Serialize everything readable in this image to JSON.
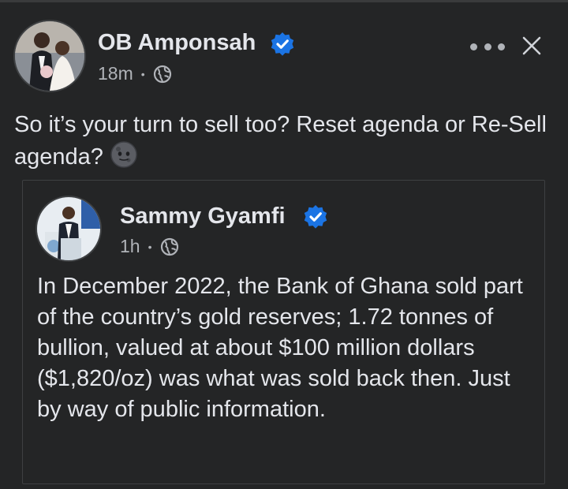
{
  "post": {
    "author": "OB Amponsah",
    "time": "18m",
    "text": "So it’s your turn to sell too? Reset agenda or Re-Sell agenda?",
    "emoji": "new-moon-face-emoji"
  },
  "shared_post": {
    "author": "Sammy Gyamfi",
    "time": "1h",
    "text": "In December 2022, the Bank of Ghana sold part of the country’s gold reserves; 1.72 tonnes of bullion, valued at about $100 million dollars ($1,820/oz) was what was sold back then. Just by way of public information."
  },
  "icons": {
    "verified": "verified-badge-icon",
    "audience": "globe-icon",
    "more": "more-options-icon",
    "close": "close-icon"
  },
  "colors": {
    "background": "#242526",
    "verified": "#1b74e4",
    "text": "#e4e6eb",
    "secondary_text": "#b0b3b8"
  },
  "separator": "•"
}
